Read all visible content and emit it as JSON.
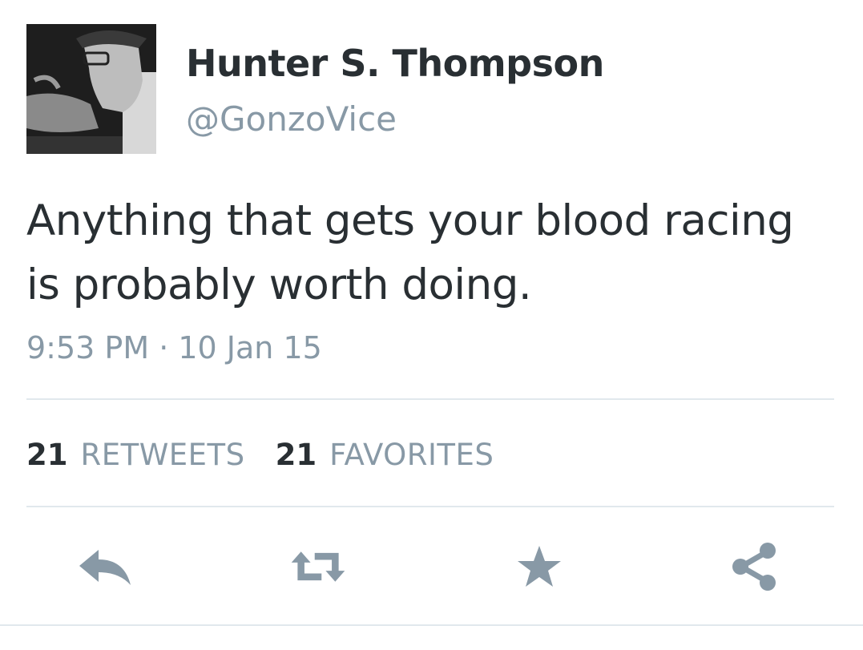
{
  "user": {
    "display_name": "Hunter S. Thompson",
    "handle": "@GonzoVice"
  },
  "tweet": {
    "text": "Anything that gets your blood racing is probably worth doing.",
    "timestamp": "9:53 PM · 10 Jan 15"
  },
  "stats": {
    "retweets_count": "21",
    "retweets_label": "RETWEETS",
    "favorites_count": "21",
    "favorites_label": "FAVORITES"
  },
  "actions": {
    "reply_icon": "reply-icon",
    "retweet_icon": "retweet-icon",
    "favorite_icon": "star-icon",
    "share_icon": "share-icon"
  },
  "colors": {
    "text_primary": "#292f33",
    "text_secondary": "#8899a6",
    "icon": "#8899a6",
    "divider": "#e1e8ed"
  }
}
